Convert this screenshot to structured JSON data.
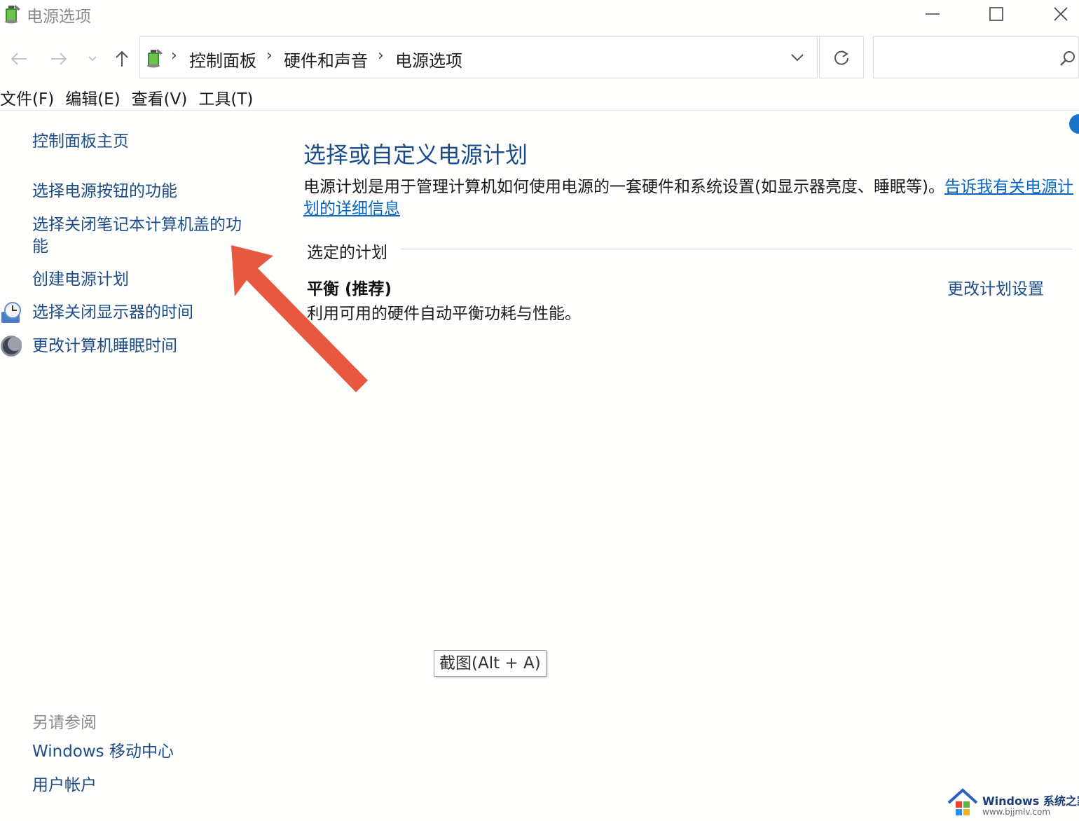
{
  "window": {
    "title": "电源选项",
    "minimize_icon": "minimize-icon",
    "maximize_icon": "maximize-icon",
    "close_icon": "close-icon"
  },
  "nav": {
    "back_icon": "arrow-left-icon",
    "forward_icon": "arrow-right-icon",
    "recent_icon": "chevron-down-icon",
    "up_icon": "arrow-up-icon",
    "breadcrumbs": [
      "控制面板",
      "硬件和声音",
      "电源选项"
    ],
    "refresh_icon": "refresh-icon",
    "search_placeholder": "",
    "search_icon": "search-icon"
  },
  "menu": [
    "文件(F)",
    "编辑(E)",
    "查看(V)",
    "工具(T)"
  ],
  "sidebar": {
    "home": "控制面板主页",
    "links": [
      "选择电源按钮的功能",
      "选择关闭笔记本计算机盖的功能",
      "创建电源计划",
      "选择关闭显示器的时间",
      "更改计算机睡眠时间"
    ],
    "see_also_title": "另请参阅",
    "see_also": [
      "Windows 移动中心",
      "用户帐户"
    ]
  },
  "main": {
    "title": "选择或自定义电源计划",
    "description": "电源计划是用于管理计算机如何使用电源的一套硬件和系统设置(如显示器亮度、睡眠等)。",
    "description_link": "告诉我有关电源计划的详细信息",
    "section_title": "选定的计划",
    "plan_name": "平衡 (推荐)",
    "plan_desc": "利用可用的硬件自动平衡功耗与性能。",
    "change_plan_link": "更改计划设置"
  },
  "tooltip": "截图(Alt + A)",
  "watermark": {
    "brand": "Windows 系统之家",
    "url": "www.bjjmlv.com"
  },
  "colors": {
    "link": "#1d4d88",
    "hyperlink": "#0b66c2",
    "title": "#1a4c8b",
    "annotation_arrow": "#e8573f"
  }
}
